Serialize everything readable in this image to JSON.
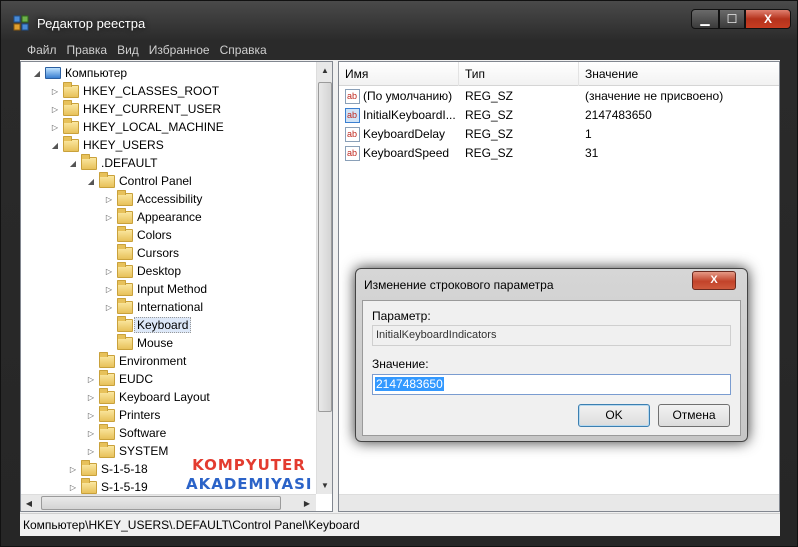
{
  "window": {
    "title": "Редактор реестра",
    "caption": {
      "minimize": "▁",
      "maximize": "☐",
      "close": "X"
    }
  },
  "menu": [
    "Файл",
    "Правка",
    "Вид",
    "Избранное",
    "Справка"
  ],
  "tree": {
    "nodes": [
      {
        "label": "Компьютер",
        "level": 0,
        "expander": "◢",
        "icon": "computer-icon"
      },
      {
        "label": "HKEY_CLASSES_ROOT",
        "level": 1,
        "expander": "▷",
        "icon": "folder-icon"
      },
      {
        "label": "HKEY_CURRENT_USER",
        "level": 1,
        "expander": "▷",
        "icon": "folder-icon"
      },
      {
        "label": "HKEY_LOCAL_MACHINE",
        "level": 1,
        "expander": "▷",
        "icon": "folder-icon"
      },
      {
        "label": "HKEY_USERS",
        "level": 1,
        "expander": "◢",
        "icon": "folder-icon"
      },
      {
        "label": ".DEFAULT",
        "level": 2,
        "expander": "◢",
        "icon": "folder-icon"
      },
      {
        "label": "Control Panel",
        "level": 3,
        "expander": "◢",
        "icon": "folder-icon"
      },
      {
        "label": "Accessibility",
        "level": 4,
        "expander": "▷",
        "icon": "folder-icon"
      },
      {
        "label": "Appearance",
        "level": 4,
        "expander": "▷",
        "icon": "folder-icon"
      },
      {
        "label": "Colors",
        "level": 4,
        "expander": "",
        "icon": "folder-icon"
      },
      {
        "label": "Cursors",
        "level": 4,
        "expander": "",
        "icon": "folder-icon"
      },
      {
        "label": "Desktop",
        "level": 4,
        "expander": "▷",
        "icon": "folder-icon"
      },
      {
        "label": "Input Method",
        "level": 4,
        "expander": "▷",
        "icon": "folder-icon"
      },
      {
        "label": "International",
        "level": 4,
        "expander": "▷",
        "icon": "folder-icon"
      },
      {
        "label": "Keyboard",
        "level": 4,
        "expander": "",
        "icon": "folder-icon",
        "selected": true
      },
      {
        "label": "Mouse",
        "level": 4,
        "expander": "",
        "icon": "folder-icon"
      },
      {
        "label": "Environment",
        "level": 3,
        "expander": "",
        "icon": "folder-icon"
      },
      {
        "label": "EUDC",
        "level": 3,
        "expander": "▷",
        "icon": "folder-icon"
      },
      {
        "label": "Keyboard Layout",
        "level": 3,
        "expander": "▷",
        "icon": "folder-icon"
      },
      {
        "label": "Printers",
        "level": 3,
        "expander": "▷",
        "icon": "folder-icon"
      },
      {
        "label": "Software",
        "level": 3,
        "expander": "▷",
        "icon": "folder-icon"
      },
      {
        "label": "SYSTEM",
        "level": 3,
        "expander": "▷",
        "icon": "folder-icon"
      },
      {
        "label": "S-1-5-18",
        "level": 2,
        "expander": "▷",
        "icon": "folder-icon"
      },
      {
        "label": "S-1-5-19",
        "level": 2,
        "expander": "▷",
        "icon": "folder-icon"
      }
    ]
  },
  "list": {
    "columns": [
      "Имя",
      "Тип",
      "Значение"
    ],
    "rows": [
      {
        "name": "(По умолчанию)",
        "type": "REG_SZ",
        "value": "(значение не присвоено)",
        "icon": "ab"
      },
      {
        "name": "InitialKeyboardI...",
        "type": "REG_SZ",
        "value": "2147483650",
        "icon": "ab",
        "selected": true
      },
      {
        "name": "KeyboardDelay",
        "type": "REG_SZ",
        "value": "1",
        "icon": "ab"
      },
      {
        "name": "KeyboardSpeed",
        "type": "REG_SZ",
        "value": "31",
        "icon": "ab"
      }
    ]
  },
  "status": "Компьютер\\HKEY_USERS\\.DEFAULT\\Control Panel\\Keyboard",
  "watermark": {
    "line1": "KOMPYUTER",
    "line2": "AKADEMIYASI"
  },
  "dialog": {
    "title": "Изменение строкового параметра",
    "close": "X",
    "param_label": "Параметр:",
    "param_value": "InitialKeyboardIndicators",
    "value_label": "Значение:",
    "value": "2147483650",
    "ok": "OK",
    "cancel": "Отмена"
  },
  "colors": {
    "accent_selection": "#3399ff",
    "close_button": "#c2432a",
    "watermark_red": "#e33b2f",
    "watermark_blue": "#2b63c8"
  }
}
